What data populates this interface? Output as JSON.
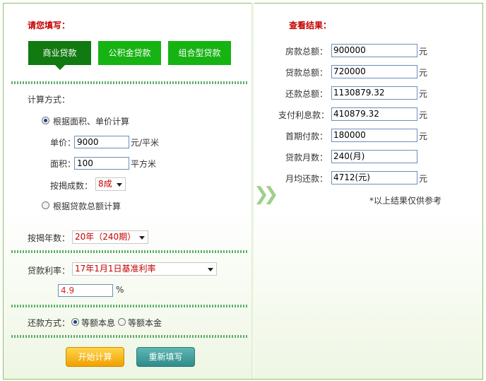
{
  "left": {
    "title": "请您填写：",
    "tabs": [
      {
        "label": "商业贷款",
        "active": true
      },
      {
        "label": "公积金贷款",
        "active": false
      },
      {
        "label": "组合型贷款",
        "active": false
      }
    ],
    "calc_method_label": "计算方式：",
    "option_by_area": "根据面积、单价计算",
    "unit_price_label": "单价：",
    "unit_price_value": "9000",
    "unit_price_unit": "元/平米",
    "area_label": "面积：",
    "area_value": "100",
    "area_unit": "平方米",
    "mortgage_ratio_label": "按揭成数：",
    "mortgage_ratio_value": "8成",
    "option_by_total": "根据贷款总额计算",
    "years_label": "按揭年数：",
    "years_value": "20年（240期）",
    "rate_label": "贷款利率：",
    "rate_value": "17年1月1日基准利率",
    "rate_percent_value": "4.9",
    "rate_percent_unit": "%",
    "repay_method_label": "还款方式：",
    "repay_equal_interest": "等额本息",
    "repay_equal_principal": "等额本金",
    "btn_calc": "开始计算",
    "btn_reset": "重新填写"
  },
  "right": {
    "title": "查看结果：",
    "rows": [
      {
        "label": "房款总额：",
        "value": "900000",
        "unit": "元"
      },
      {
        "label": "贷款总额：",
        "value": "720000",
        "unit": "元"
      },
      {
        "label": "还款总额：",
        "value": "1130879.32",
        "unit": "元"
      },
      {
        "label": "支付利息款：",
        "value": "410879.32",
        "unit": "元"
      },
      {
        "label": "首期付款：",
        "value": "180000",
        "unit": "元"
      },
      {
        "label": "贷款月数：",
        "value": "240(月)",
        "unit": ""
      },
      {
        "label": "月均还款：",
        "value": "4712(元)",
        "unit": "元"
      }
    ],
    "note": "*以上结果仅供参考"
  },
  "colors": {
    "title_red": "#c40000",
    "tab_active": "#117a11",
    "tab_inactive": "#16b313",
    "btn_orange": "#f0a000",
    "btn_teal": "#2f8c8a"
  }
}
